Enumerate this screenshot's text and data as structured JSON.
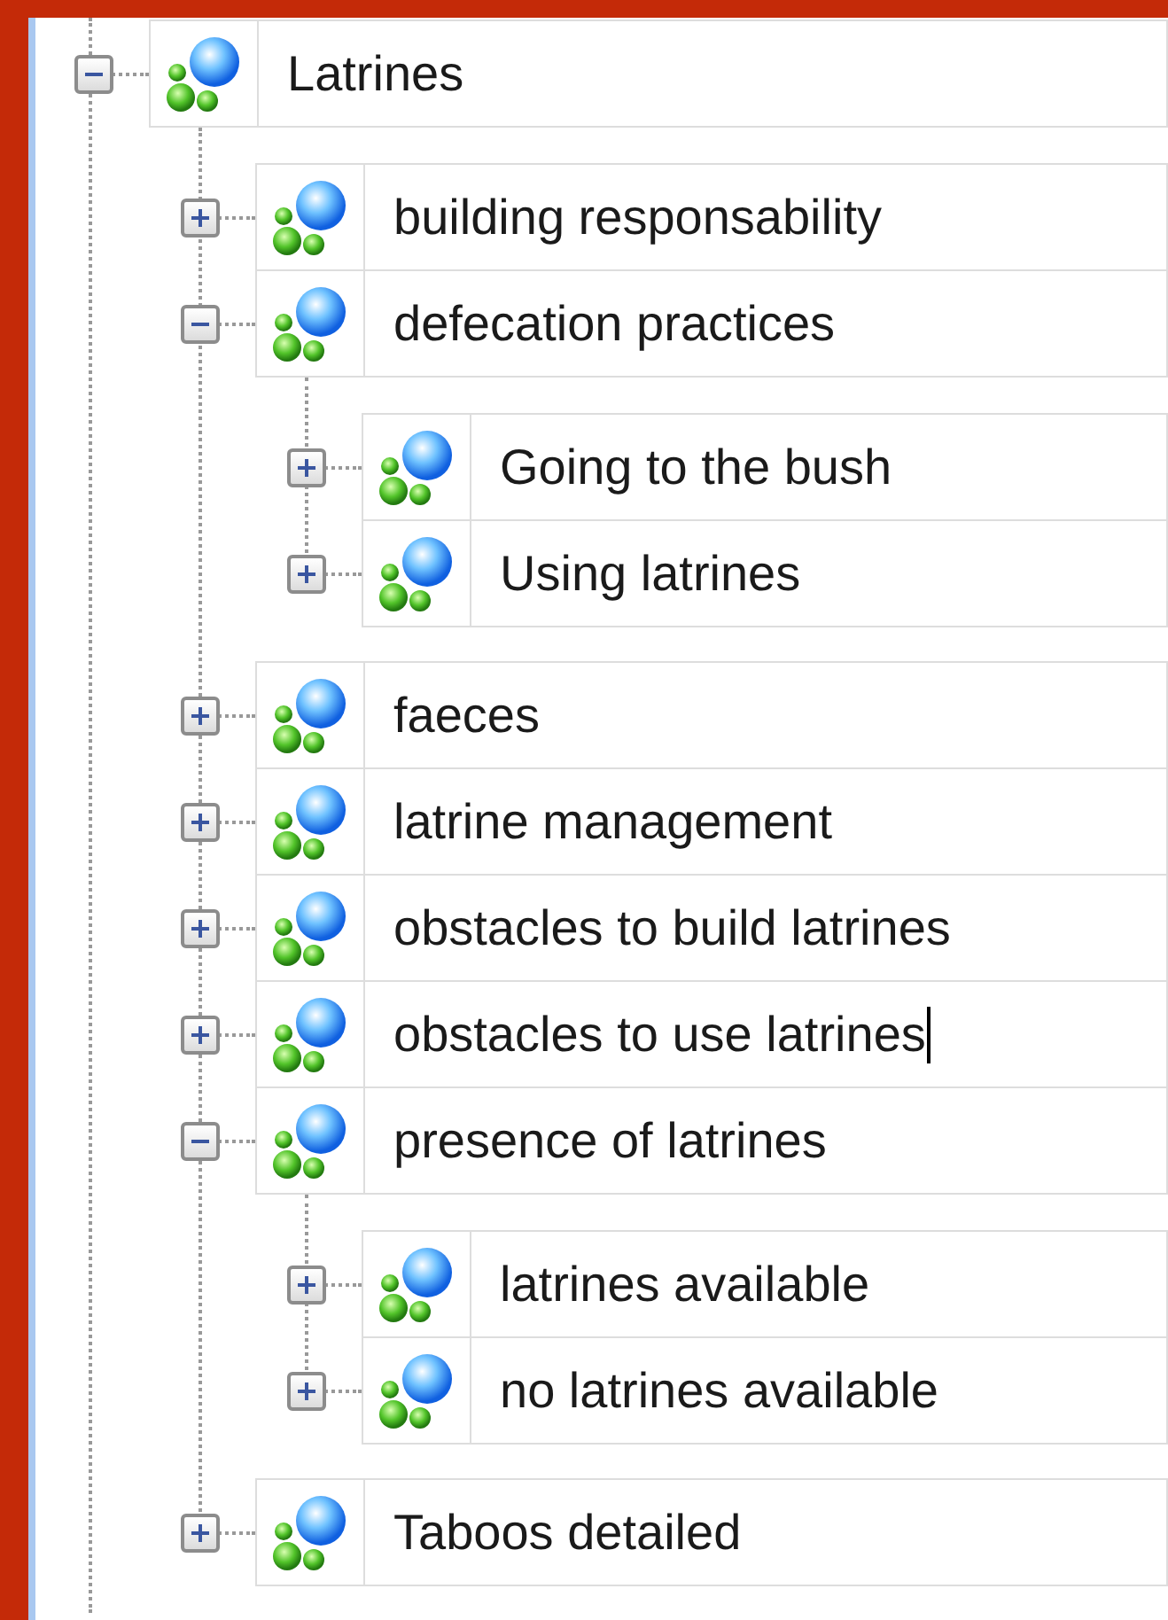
{
  "tree": [
    {
      "label": "Latrines",
      "expanded": true,
      "editing": false,
      "children": [
        {
          "label": "building responsability",
          "expanded": false,
          "editing": false
        },
        {
          "label": "defecation practices",
          "expanded": true,
          "editing": false,
          "children": [
            {
              "label": "Going to the bush",
              "expanded": false,
              "editing": false
            },
            {
              "label": "Using latrines",
              "expanded": false,
              "editing": false
            }
          ]
        },
        {
          "label": "faeces",
          "expanded": false,
          "editing": false
        },
        {
          "label": "latrine management",
          "expanded": false,
          "editing": false
        },
        {
          "label": "obstacles to build latrines",
          "expanded": false,
          "editing": false
        },
        {
          "label": "obstacles to use latrines",
          "expanded": false,
          "editing": true
        },
        {
          "label": "presence of latrines",
          "expanded": true,
          "editing": false,
          "children": [
            {
              "label": "latrines available",
              "expanded": false,
              "editing": false
            },
            {
              "label": "no latrines available",
              "expanded": false,
              "editing": false
            }
          ]
        },
        {
          "label": "Taboos detailed",
          "expanded": false,
          "editing": false
        }
      ]
    }
  ]
}
